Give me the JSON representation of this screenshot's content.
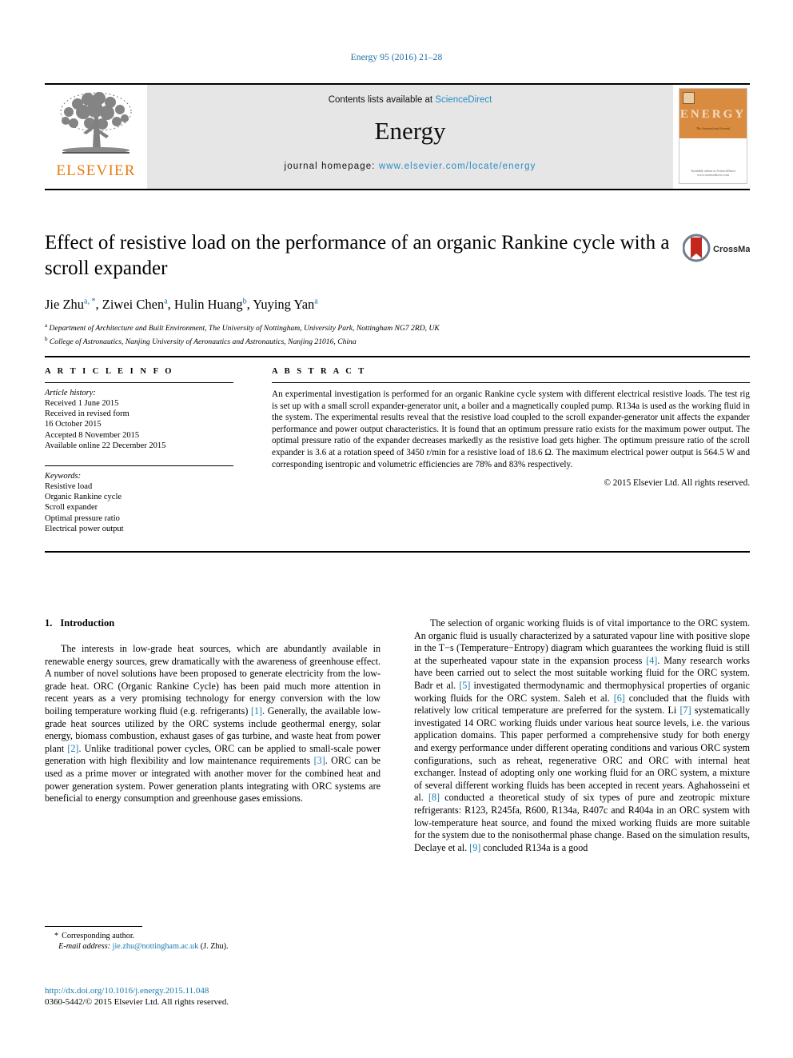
{
  "running_head": "Energy 95 (2016) 21–28",
  "masthead": {
    "publisher_name": "ELSEVIER",
    "contents_prefix": "Contents lists available at ",
    "contents_link": "ScienceDirect",
    "journal_title": "Energy",
    "homepage_prefix": "journal homepage: ",
    "homepage_url": "www.elsevier.com/locate/energy",
    "cover": {
      "masthead_word": "ENERGY",
      "subtitle": "The International Journal",
      "footer": "Available online at\nScienceDirect\nwww.sciencedirect.com"
    }
  },
  "article": {
    "title": "Effect of resistive load on the performance of an organic Rankine cycle with a scroll expander",
    "crossmark_label": "CrossMark",
    "authors": [
      {
        "name": "Jie Zhu",
        "marks": "a, *"
      },
      {
        "name": "Ziwei Chen",
        "marks": "a"
      },
      {
        "name": "Hulin Huang",
        "marks": "b"
      },
      {
        "name": "Yuying Yan",
        "marks": "a"
      }
    ],
    "affiliations": [
      {
        "mark": "a",
        "text": "Department of Architecture and Built Environment, The University of Nottingham, University Park, Nottingham NG7 2RD, UK"
      },
      {
        "mark": "b",
        "text": "College of Astronautics, Nanjing University of Aeronautics and Astronautics, Nanjing 21016, China"
      }
    ]
  },
  "article_info": {
    "heading": "A R T I C L E  I N F O",
    "history_label": "Article history:",
    "history": [
      "Received 1 June 2015",
      "Received in revised form",
      "16 October 2015",
      "Accepted 8 November 2015",
      "Available online 22 December 2015"
    ],
    "keywords_label": "Keywords:",
    "keywords": [
      "Resistive load",
      "Organic Rankine cycle",
      "Scroll expander",
      "Optimal pressure ratio",
      "Electrical power output"
    ]
  },
  "abstract": {
    "heading": "A B S T R A C T",
    "text": "An experimental investigation is performed for an organic Rankine cycle system with different electrical resistive loads. The test rig is set up with a small scroll expander-generator unit, a boiler and a magnetically coupled pump. R134a is used as the working fluid in the system. The experimental results reveal that the resistive load coupled to the scroll expander-generator unit affects the expander performance and power output characteristics. It is found that an optimum pressure ratio exists for the maximum power output. The optimal pressure ratio of the expander decreases markedly as the resistive load gets higher. The optimum pressure ratio of the scroll expander is 3.6 at a rotation speed of 3450 r/min for a resistive load of 18.6 Ω. The maximum electrical power output is 564.5 W and corresponding isentropic and volumetric efficiencies are 78% and 83% respectively.",
    "copyright": "© 2015 Elsevier Ltd. All rights reserved."
  },
  "body": {
    "section_number": "1.",
    "section_title": "Introduction",
    "left_paragraph_part1": "The interests in low-grade heat sources, which are abundantly available in renewable energy sources, grew dramatically with the awareness of greenhouse effect. A number of novel solutions have been proposed to generate electricity from the low-grade heat. ORC (Organic Rankine Cycle) has been paid much more attention in recent years as a very promising technology for energy conversion with the low boiling temperature working fluid (e.g. refrigerants) ",
    "left_ref1": "[1]",
    "left_paragraph_part2": ". Generally, the available low-grade heat sources utilized by the ORC systems include geothermal energy, solar energy, biomass combustion, exhaust gases of gas turbine, and waste heat from power plant ",
    "left_ref2": "[2]",
    "left_paragraph_part3": ". Unlike traditional power cycles, ORC can be applied to small-scale power generation with high flexibility and low maintenance requirements ",
    "left_ref3": "[3]",
    "left_paragraph_part4": ". ORC can be used as a prime mover or integrated with another mover for the combined heat and power generation system. Power generation plants integrating with ORC systems are beneficial to energy consumption and greenhouse gases emissions.",
    "right_paragraph_part1": "The selection of organic working fluids is of vital importance to the ORC system. An organic fluid is usually characterized by a saturated vapour line with positive slope in the T−s (Temperature−Entropy) diagram which guarantees the working fluid is still at the superheated vapour state in the expansion process ",
    "right_ref4": "[4]",
    "right_paragraph_part2": ". Many research works have been carried out to select the most suitable working fluid for the ORC system. Badr et al. ",
    "right_ref5": "[5]",
    "right_paragraph_part3": " investigated thermodynamic and thermophysical properties of organic working fluids for the ORC system. Saleh et al. ",
    "right_ref6": "[6]",
    "right_paragraph_part4": " concluded that the fluids with relatively low critical temperature are preferred for the system. Li ",
    "right_ref7": "[7]",
    "right_paragraph_part5": " systematically investigated 14 ORC working fluids under various heat source levels, i.e. the various application domains. This paper performed a comprehensive study for both energy and exergy performance under different operating conditions and various ORC system configurations, such as reheat, regenerative ORC and ORC with internal heat exchanger. Instead of adopting only one working fluid for an ORC system, a mixture of several different working fluids has been accepted in recent years. Aghahosseini et al. ",
    "right_ref8": "[8]",
    "right_paragraph_part6": " conducted a theoretical study of six types of pure and zeotropic mixture refrigerants: R123, R245fa, R600, R134a, R407c and R404a in an ORC system with low-temperature heat source, and found the mixed working fluids are more suitable for the system due to the nonisothermal phase change. Based on the simulation results, Declaye et al. ",
    "right_ref9": "[9]",
    "right_paragraph_part7": " concluded R134a is a good"
  },
  "footnote": {
    "corresponding_star": "*",
    "corresponding_label": "Corresponding author.",
    "email_label": "E-mail address:",
    "email": "jie.zhu@nottingham.ac.uk",
    "email_owner": "(J. Zhu).",
    "doi": "http://dx.doi.org/10.1016/j.energy.2015.11.048",
    "issn": "0360-5442/© 2015 Elsevier Ltd. All rights reserved."
  },
  "colors": {
    "link_blue": "#1a7aad",
    "elsevier_orange": "#e87b10",
    "masthead_gray": "#e6e6e6",
    "cover_orange": "#d98c3f",
    "crossmark_red": "#c4271e"
  }
}
